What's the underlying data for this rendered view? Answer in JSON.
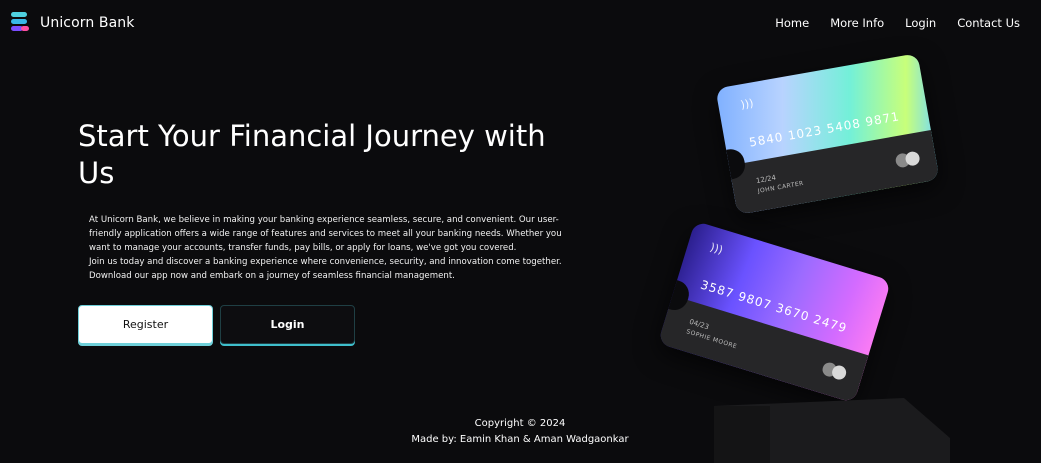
{
  "navbar": {
    "brand": "Unicorn Bank",
    "logo_icon": "stacked-layers-icon",
    "links": [
      "Home",
      "More Info",
      "Login",
      "Contact Us"
    ]
  },
  "hero": {
    "title": "Start Your Financial Journey with Us",
    "paragraph_1": "At Unicorn Bank, we believe in making your banking experience seamless, secure, and convenient. Our user-friendly application offers a wide range of features and services to meet all your banking needs. Whether you want to manage your accounts, transfer funds, pay bills, or apply for loans, we've got you covered.",
    "paragraph_2": "Join us today and discover a banking experience where convenience, security, and innovation come together.",
    "paragraph_3": "Download our app now and embark on a journey of seamless financial management.",
    "register_label": "Register",
    "login_label": "Login"
  },
  "cards": [
    {
      "number": "5840 1023 5408 9871",
      "expiry": "12/24",
      "holder": "JOHN CARTER"
    },
    {
      "number": "3587 9807 3670 2479",
      "expiry": "04/23",
      "holder": "SOPHIE MOORE"
    }
  ],
  "footer": {
    "copyright": "Copyright © 2024",
    "made_by": "Made by: Eamin Khan & Aman Wadgaonkar"
  },
  "colors": {
    "background": "#0b0b0d",
    "accent": "#3fbfcc"
  }
}
